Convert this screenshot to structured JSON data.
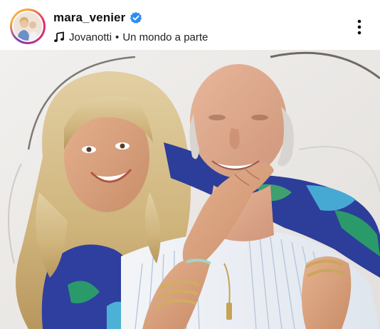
{
  "post": {
    "username": "mara_venier",
    "verified": true,
    "music_artist": "Jovanotti",
    "music_separator": "•",
    "music_title": "Un mondo a parte",
    "avatar_icon": "profile-avatar",
    "verified_icon": "verified-badge-icon",
    "music_icon": "music-note-icon",
    "more_icon": "more-options-icon"
  },
  "colors": {
    "verified_blue": "#2a8df4",
    "text": "#111111",
    "background": "#ffffff"
  },
  "photo": {
    "description_icon": "post-photo"
  }
}
